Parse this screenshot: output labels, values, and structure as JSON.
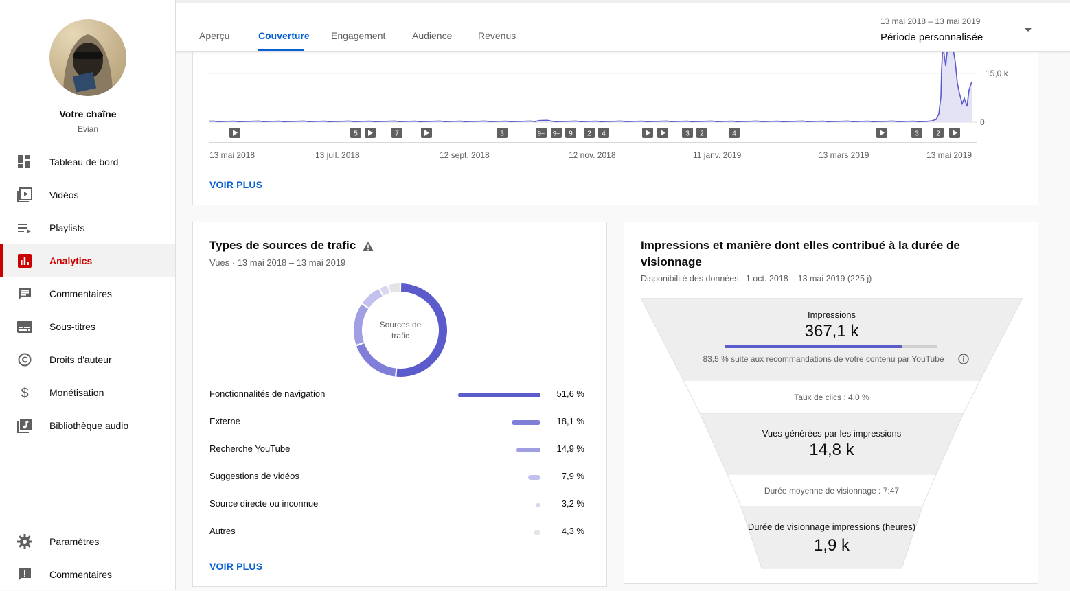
{
  "sidebar": {
    "channel_name": "Votre chaîne",
    "channel_sub": "Evian",
    "items": [
      {
        "label": "Tableau de bord",
        "icon": "dashboard-icon"
      },
      {
        "label": "Vidéos",
        "icon": "videos-icon"
      },
      {
        "label": "Playlists",
        "icon": "playlists-icon"
      },
      {
        "label": "Analytics",
        "icon": "analytics-icon",
        "active": true
      },
      {
        "label": "Commentaires",
        "icon": "comments-icon"
      },
      {
        "label": "Sous-titres",
        "icon": "subtitles-icon"
      },
      {
        "label": "Droits d'auteur",
        "icon": "copyright-icon"
      },
      {
        "label": "Monétisation",
        "icon": "dollar-icon"
      },
      {
        "label": "Bibliothèque audio",
        "icon": "audio-library-icon"
      }
    ],
    "bottom_items": [
      {
        "label": "Paramètres",
        "icon": "gear-icon"
      },
      {
        "label": "Commentaires",
        "icon": "feedback-icon"
      }
    ]
  },
  "header": {
    "tabs": [
      "Aperçu",
      "Couverture",
      "Engagement",
      "Audience",
      "Revenus"
    ],
    "active_tab": "Couverture",
    "date_range": "13 mai 2018 – 13 mai 2019",
    "period": "Période personnalisée"
  },
  "top_chart": {
    "chart_data": {
      "type": "line",
      "y_ticks": [
        "15,0 k",
        "0"
      ],
      "x_ticks": [
        "13 mai 2018",
        "13 juil. 2018",
        "12 sept. 2018",
        "12 nov. 2018",
        "11 janv. 2019",
        "13 mars 2019",
        "13 mai 2019"
      ],
      "ylim": [
        0,
        20000
      ],
      "series_color": "#5c5bcc",
      "markers": [
        "▶",
        "5",
        "▶",
        "7",
        "▶",
        "3",
        "9+",
        "9+",
        "9",
        "2",
        "4",
        "▶",
        "▶",
        "3",
        "2",
        "4",
        "▶",
        "3",
        "2",
        "▶"
      ]
    },
    "voir_plus": "VOIR PLUS"
  },
  "traffic": {
    "title": "Types de sources de trafic",
    "subtitle": "Vues · 13 mai 2018 – 13 mai 2019",
    "donut_label_1": "Sources de",
    "donut_label_2": "trafic",
    "chart_data": {
      "type": "pie",
      "categories": [
        "Fonctionnalités de navigation",
        "Externe",
        "Recherche YouTube",
        "Suggestions de vidéos",
        "Source directe ou inconnue",
        "Autres"
      ],
      "values": [
        51.6,
        18.1,
        14.9,
        7.9,
        3.2,
        4.3
      ],
      "colors": [
        "#5c5bcc",
        "#7f7ed9",
        "#a09fe4",
        "#c2c1ee",
        "#d9d8f0",
        "#e4e4e4"
      ]
    },
    "rows": [
      {
        "name": "Fonctionnalités de navigation",
        "value": "51,6 %",
        "fraction": 0.516
      },
      {
        "name": "Externe",
        "value": "18,1 %",
        "fraction": 0.181
      },
      {
        "name": "Recherche YouTube",
        "value": "14,9 %",
        "fraction": 0.149
      },
      {
        "name": "Suggestions de vidéos",
        "value": "7,9 %",
        "fraction": 0.079
      },
      {
        "name": "Source directe ou inconnue",
        "value": "3,2 %",
        "fraction": 0.032
      },
      {
        "name": "Autres",
        "value": "4,3 %",
        "fraction": 0.043
      }
    ],
    "voir_plus": "VOIR PLUS"
  },
  "funnel": {
    "title_line1": "Impressions et manière dont elles contribué à la durée de",
    "title_line2": "visionnage",
    "subtitle": "Disponibilité des données : 1 oct. 2018 – 13 mai 2019 (225 j)",
    "impressions_label": "Impressions",
    "impressions_value": "367,1 k",
    "impressions_progress": 0.835,
    "impressions_note": "83,5 % suite aux recommandations de votre contenu par YouTube",
    "ctr": "Taux de clics : 4,0 %",
    "views_label": "Vues générées par les impressions",
    "views_value": "14,8 k",
    "avg_duration": "Durée moyenne de visionnage : 7:47",
    "watch_label": "Durée de visionnage impressions (heures)",
    "watch_value": "1,9 k"
  }
}
